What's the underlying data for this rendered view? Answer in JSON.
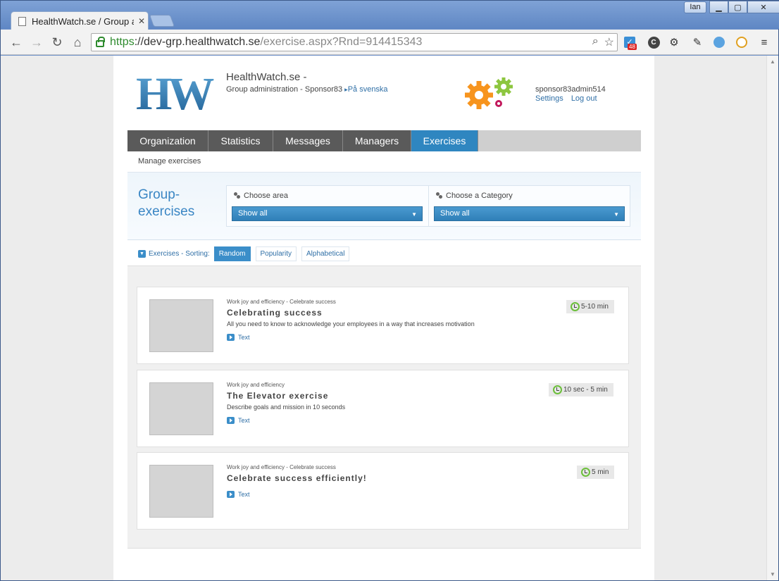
{
  "browser": {
    "tab_title": "HealthWatch.se / Group a",
    "user_button": "Ian",
    "url_scheme": "https",
    "url_host": "://dev-grp.healthwatch.se",
    "url_path": "/exercise.aspx?Rnd=914415343",
    "extension_badge": "48"
  },
  "header": {
    "logo_text": "HW",
    "site_title": "HealthWatch.se -",
    "subtitle": "Group administration - Sponsor83",
    "language_link": "På svenska",
    "username": "sponsor83admin514",
    "settings_link": "Settings",
    "logout_link": "Log out"
  },
  "nav": {
    "items": [
      {
        "label": "Organization",
        "active": false
      },
      {
        "label": "Statistics",
        "active": false
      },
      {
        "label": "Messages",
        "active": false
      },
      {
        "label": "Managers",
        "active": false
      },
      {
        "label": "Exercises",
        "active": true
      }
    ],
    "sub_label": "Manage exercises"
  },
  "filter": {
    "title_line1": "Group-",
    "title_line2": "exercises",
    "area_label": "Choose area",
    "area_value": "Show all",
    "category_label": "Choose a Category",
    "category_value": "Show all"
  },
  "sorting": {
    "label": "Exercises - Sorting:",
    "options": [
      "Random",
      "Popularity",
      "Alphabetical"
    ],
    "active": "Random"
  },
  "exercises": [
    {
      "category": "Work joy and efficiency - Celebrate success",
      "title": "Celebrating success",
      "description": "All you need to know to acknowledge your employees in a way that increases motivation",
      "link": "Text",
      "duration": "5-10 min"
    },
    {
      "category": "Work joy and efficiency",
      "title": "The Elevator exercise",
      "description": "Describe goals and mission in 10 seconds",
      "link": "Text",
      "duration": "10 sec - 5 min"
    },
    {
      "category": "Work joy and efficiency - Celebrate success",
      "title": "Celebrate success efficiently!",
      "description": "",
      "link": "Text",
      "duration": "5 min"
    }
  ],
  "colors": {
    "accent": "#2f86c0",
    "nav_dark": "#5a5a5a",
    "clock_green": "#6cbf3a"
  }
}
